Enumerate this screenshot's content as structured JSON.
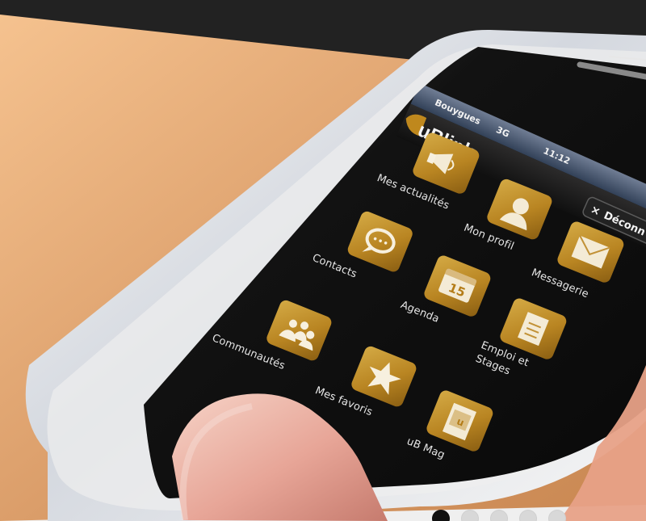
{
  "statusBar": {
    "carrier": "Bouygues",
    "network": "3G",
    "time": "11:12"
  },
  "header": {
    "logo": "uBlink",
    "logoutLabel": "Déconn"
  },
  "apps": [
    {
      "label": "Mes actualités",
      "icon": "megaphone-icon"
    },
    {
      "label": "Mon profil",
      "icon": "user-icon"
    },
    {
      "label": "Messagerie",
      "icon": "envelope-icon"
    },
    {
      "label": "Contacts",
      "icon": "chat-bubble-icon"
    },
    {
      "label": "Agenda",
      "icon": "calendar-icon",
      "badge": "15"
    },
    {
      "label": "Emploi et",
      "label2": "Stages",
      "icon": "document-icon"
    },
    {
      "label": "Communautés",
      "icon": "people-icon"
    },
    {
      "label": "Mes favoris",
      "icon": "star-icon"
    },
    {
      "label": "uB Mag",
      "icon": "magazine-icon",
      "badge": "u"
    }
  ],
  "carousel": {
    "active_index": 0,
    "count": 5
  },
  "colors": {
    "topBand": "#222222",
    "bottomBand": "#efefef",
    "iconGold": "#c79932",
    "screenBg": "#141414",
    "phoneBody": "#ececec",
    "skin": "#f0b78c"
  }
}
